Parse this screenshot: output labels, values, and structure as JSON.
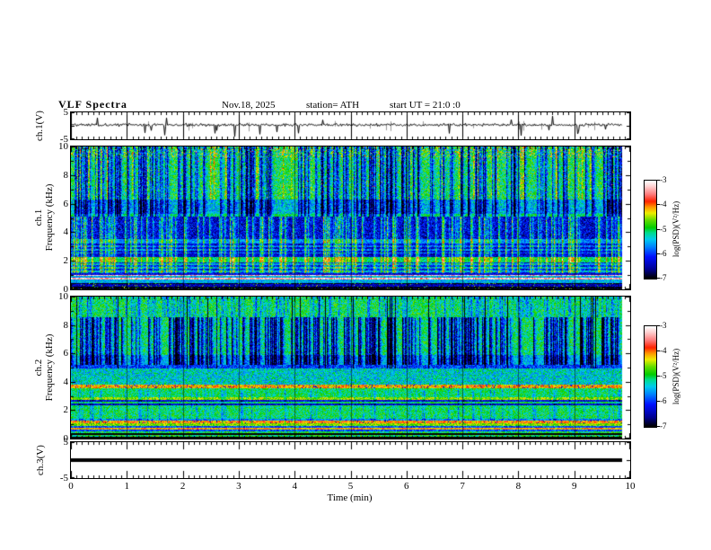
{
  "figure": {
    "name": "VLF Spectra multi-panel plot",
    "background": "#ffffff",
    "frame_color": "#000000"
  },
  "header": {
    "title": "VLF Spectra",
    "date": "Nov.18, 2025",
    "station": "station= ATH",
    "start_ut": "start UT =  21:0 :0"
  },
  "left_labels": {
    "ch1v": "ch.1(V)",
    "ch1": "ch.1",
    "ch2": "ch.2",
    "freq": "Frequency (kHz)",
    "ch3v": "ch.3(V)"
  },
  "x_axis": {
    "label": "Time (min)",
    "min": 0,
    "max": 10,
    "major_ticks": [
      0,
      1,
      2,
      3,
      4,
      5,
      6,
      7,
      8,
      9,
      10
    ],
    "minor_step": 0.1,
    "data_end": 9.85
  },
  "colorbar": {
    "label": "log(PSD)(V²/Hz)",
    "min": -7,
    "max": -3,
    "ticks": [
      -3,
      -4,
      -5,
      -6,
      -7
    ],
    "stops": [
      [
        0.0,
        "#000000"
      ],
      [
        0.09,
        "#000090"
      ],
      [
        0.22,
        "#0010ff"
      ],
      [
        0.32,
        "#0080ff"
      ],
      [
        0.4,
        "#00ccee"
      ],
      [
        0.47,
        "#00dd88"
      ],
      [
        0.52,
        "#00cc00"
      ],
      [
        0.6,
        "#66dd00"
      ],
      [
        0.67,
        "#eeee00"
      ],
      [
        0.73,
        "#ff9900"
      ],
      [
        0.79,
        "#ff2200"
      ],
      [
        0.86,
        "#ff7777"
      ],
      [
        0.94,
        "#ffcccc"
      ],
      [
        1.0,
        "#ffffff"
      ]
    ]
  },
  "chart_data": [
    {
      "id": "ch1_waveform",
      "panel": "wave1",
      "type": "line",
      "ylabel": "ch.1(V)",
      "ylim": [
        -5,
        5
      ],
      "yticks": [
        5,
        -5
      ],
      "xlim": [
        0,
        10
      ],
      "seed": 11,
      "baseline": 0.35,
      "noise_sd": 0.5,
      "spike_down": {
        "rate": 0.03,
        "min": 1.2,
        "max": 4.2
      },
      "spike_up": {
        "rate": 0.015,
        "min": 1.0,
        "max": 3.5
      },
      "gray_rate": 0.02,
      "description": "Broadband noisy ch.1 voltage trace near +0.3 V with frequent impulsive spikes"
    },
    {
      "id": "ch1_spectrogram",
      "panel": "spec1",
      "type": "heatmap",
      "ylabel": "ch.1 Frequency (kHz)",
      "ylim": [
        0,
        10
      ],
      "yticks": [
        0,
        2,
        4,
        6,
        8,
        10
      ],
      "ytick_minor_step": 1,
      "xlim": [
        0,
        10
      ],
      "value_range": [
        -7,
        -3
      ],
      "seed": 42,
      "bands": [
        {
          "f": [
            9.3,
            10
          ],
          "base": -4.9,
          "noise": 0.8,
          "speck": {
            "prob": 0.02,
            "v": -3.7
          }
        },
        {
          "f": [
            6.3,
            9.3
          ],
          "base": -5.0,
          "noise": 0.55,
          "speck": {
            "prob": 0.006,
            "v": -3.8
          }
        },
        {
          "f": [
            5.3,
            6.3
          ],
          "base": -5.45,
          "noise": 0.5
        },
        {
          "f": [
            5.1,
            5.3
          ],
          "base": -5.0,
          "noise": 0.3
        },
        {
          "f": [
            3.55,
            5.1
          ],
          "base": -6.35,
          "noise": 0.55
        },
        {
          "f": [
            3.3,
            3.55
          ],
          "base": -5.7,
          "noise": 0.4
        },
        {
          "f": [
            2.55,
            3.3
          ],
          "base": -6.1,
          "noise": 0.45,
          "stripes": {
            "period": 2,
            "amp": 0.3
          }
        },
        {
          "f": [
            2.3,
            2.55
          ],
          "base": -6.4,
          "noise": 0.4
        },
        {
          "f": [
            1.9,
            2.3
          ],
          "base": -5.1,
          "noise": 0.35
        },
        {
          "f": [
            1.15,
            1.9
          ],
          "base": -5.85,
          "noise": 0.5,
          "stripes": {
            "period": 2,
            "amp": 0.35
          }
        },
        {
          "f": [
            1.05,
            1.15
          ],
          "base": -6.3,
          "noise": 0.4
        },
        {
          "f": [
            0.68,
            1.05
          ],
          "base": -4.4,
          "noise": 0.45,
          "stripes": {
            "period": 2,
            "amp": 1.1
          }
        },
        {
          "f": [
            0.45,
            0.68
          ],
          "base": -5.5,
          "noise": 0.4
        },
        {
          "f": [
            0,
            0.45
          ],
          "base": -6.75,
          "noise": 0.4,
          "speck": {
            "prob": 0.05,
            "v": -4.6
          },
          "stripes": {
            "period": 3,
            "amp": 0.3
          }
        }
      ],
      "streaks": [
        {
          "f": [
            5.1,
            10
          ],
          "delta": -1.5,
          "density": 0.3,
          "decay": 0.5
        },
        {
          "f": [
            6.3,
            10
          ],
          "delta": 0.6,
          "density": 0.12,
          "decay": 0.3
        },
        {
          "f": [
            1.15,
            5.1
          ],
          "delta": 1.15,
          "density": 0.22,
          "decay": 0.45
        }
      ],
      "description": "ch.1 VLF spectrogram: green/yellow 6-10 kHz with cyan sferic streaks, dark-blue 2.5-5 kHz band, layered cyan/blue lines below 2.5 kHz, bright line near 0.8 kHz, near-black below 0.5 kHz"
    },
    {
      "id": "ch2_spectrogram",
      "panel": "spec2",
      "type": "heatmap",
      "ylabel": "ch.2 Frequency (kHz)",
      "ylim": [
        0,
        10
      ],
      "yticks": [
        0,
        2,
        4,
        6,
        8,
        10
      ],
      "ytick_minor_step": 1,
      "xlim": [
        0,
        10
      ],
      "value_range": [
        -7,
        -3
      ],
      "seed": 1337,
      "bands": [
        {
          "f": [
            8.6,
            10
          ],
          "base": -5.0,
          "noise": 0.5
        },
        {
          "f": [
            5.9,
            8.6
          ],
          "base": -5.05,
          "noise": 0.5
        },
        {
          "f": [
            5.2,
            5.9
          ],
          "base": -5.5,
          "noise": 0.45
        },
        {
          "f": [
            4.95,
            5.2
          ],
          "base": -6.0,
          "noise": 0.5
        },
        {
          "f": [
            3.85,
            4.95
          ],
          "base": -5.35,
          "noise": 0.5
        },
        {
          "f": [
            3.6,
            3.85
          ],
          "base": -4.15,
          "noise": 0.45,
          "speck": {
            "prob": 0.08,
            "v": -6.3
          }
        },
        {
          "f": [
            2.95,
            3.6
          ],
          "base": -5.05,
          "noise": 0.4
        },
        {
          "f": [
            2.75,
            2.95
          ],
          "base": -4.5,
          "noise": 0.4
        },
        {
          "f": [
            2.62,
            2.75
          ],
          "base": -6.2,
          "noise": 0.4
        },
        {
          "f": [
            2.5,
            2.62
          ],
          "base": -5.0,
          "noise": 0.35
        },
        {
          "f": [
            2.38,
            2.5
          ],
          "base": -6.3,
          "noise": 0.4
        },
        {
          "f": [
            1.45,
            2.38
          ],
          "base": -5.05,
          "noise": 0.45
        },
        {
          "f": [
            1.3,
            1.45
          ],
          "base": -5.6,
          "noise": 0.5
        },
        {
          "f": [
            1.08,
            1.3
          ],
          "base": -4.0,
          "noise": 0.4,
          "speck": {
            "prob": 0.05,
            "v": -6.5
          }
        },
        {
          "f": [
            0.92,
            1.08
          ],
          "base": -4.6,
          "noise": 0.35
        },
        {
          "f": [
            0.55,
            0.92
          ],
          "base": -5.0,
          "noise": 0.45,
          "stripes": {
            "period": 2,
            "amp": 0.9
          }
        },
        {
          "f": [
            0,
            0.55
          ],
          "base": -6.3,
          "noise": 0.5,
          "stripes": {
            "period": 2,
            "amp": 1.3
          }
        }
      ],
      "streaks": [
        {
          "f": [
            5.2,
            8.6
          ],
          "delta": -1.7,
          "density": 0.3,
          "decay": 0.5
        },
        {
          "f": [
            8.6,
            10
          ],
          "delta": -0.6,
          "density": 0.25,
          "decay": 0.4
        },
        {
          "f": [
            4.95,
            10
          ],
          "delta": -2.4,
          "density": 0.045,
          "decay": 0.0
        },
        {
          "f": [
            1.12,
            3.45
          ],
          "delta": -0.45,
          "density": 0.12,
          "decay": 0.3
        }
      ],
      "description": "ch.2 VLF spectrogram: green 5-10 kHz with dense blue/black vertical streaks, red-orange horizontal band near 3.7 kHz, yellow band near 2.8 kHz, red band near 1.2 kHz, black striped bands below 0.6 kHz"
    },
    {
      "id": "ch3_waveform",
      "panel": "wave3",
      "type": "line",
      "ylabel": "ch.3(V)",
      "ylim": [
        -5,
        5
      ],
      "yticks": [
        5,
        -5
      ],
      "xlim": [
        0,
        10
      ],
      "value": 0,
      "thickness": 4,
      "description": "Flat ch.3 trace at 0 V (thick black line)"
    }
  ]
}
